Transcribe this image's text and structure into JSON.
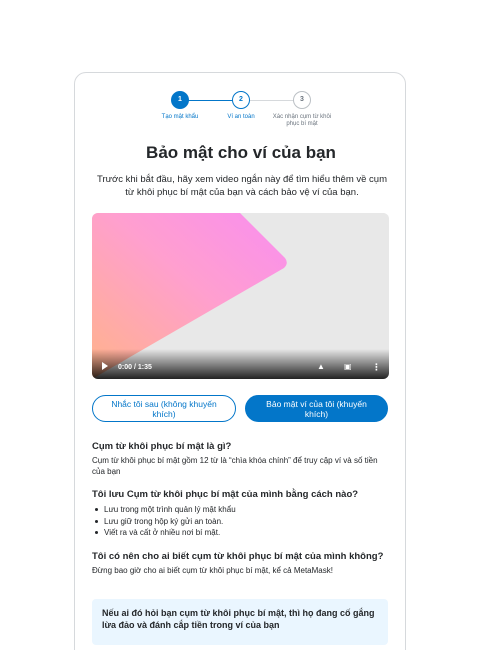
{
  "stepper": {
    "steps": [
      {
        "number": "1",
        "label": "Tạo mật khẩu"
      },
      {
        "number": "2",
        "label": "Ví an toàn"
      },
      {
        "number": "3",
        "label": "Xác nhận cụm từ khôi phục bí mật"
      }
    ],
    "active_step": 1
  },
  "page": {
    "title": "Bảo mật cho ví của bạn",
    "intro": "Trước khi bắt đầu, hãy xem video ngắn này để tìm hiểu thêm về cụm từ khôi phục bí mật của bạn và cách bảo vệ ví của bạn."
  },
  "video": {
    "time": "0:00 / 1:35",
    "progress": 0,
    "icons": [
      "play-icon",
      "volume-icon",
      "fullscreen-icon",
      "more-icon"
    ]
  },
  "buttons": {
    "remind_later": "Nhắc tôi sau (không khuyến khích)",
    "secure_wallet": "Bảo mật ví của tôi (khuyến khích)"
  },
  "faq": {
    "q1": "Cụm từ khôi phục bí mật là gì?",
    "a1": "Cụm từ khôi phục bí mật gồm 12 từ là “chìa khóa chính” để truy cập ví và số tiền của bạn",
    "q2": "Tôi lưu Cụm từ khôi phục bí mật của mình bằng cách nào?",
    "a2_items": [
      "Lưu trong một trình quản lý mật khẩu",
      "Lưu giữ trong hộp ký gửi an toàn.",
      "Viết ra và cất ở nhiều nơi bí mật."
    ],
    "q3": "Tôi có nên cho ai biết cụm từ khôi phục bí mật của mình không?",
    "a3": "Đừng bao giờ cho ai biết cụm từ khôi phục bí mật, kể cả MetaMask!"
  },
  "warning": {
    "text": "Nếu ai đó hỏi bạn cụm từ khôi phục bí mật, thì họ đang cố gắng lừa đảo và đánh cắp tiền trong ví của bạn"
  },
  "colors": {
    "primary": "#0376c9",
    "warning_bg": "#eaf6ff",
    "text": "#24272a"
  }
}
